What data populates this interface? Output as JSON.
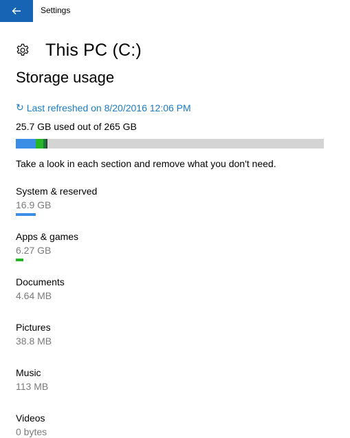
{
  "window": {
    "app_title": "Settings"
  },
  "header": {
    "title": "This PC (C:)"
  },
  "section": {
    "title": "Storage usage"
  },
  "refresh": {
    "icon": "↻",
    "label": "Last refreshed on 8/20/2016 12:06 PM"
  },
  "summary": {
    "used_text": "25.7 GB used out of 265 GB",
    "used_gb": 25.7,
    "total_gb": 265
  },
  "hint": "Take a look in each section and remove what you don't need.",
  "colors": {
    "accent": "#1764b5",
    "link": "#1a7bc9",
    "system_bar": "#3a8ee6",
    "apps_bar": "#26b526",
    "other_bar": "#1a7a3a",
    "bar_track": "#d4d4d4"
  },
  "categories": [
    {
      "name": "System & reserved",
      "size": "16.9 GB",
      "has_bar": true,
      "bar_color": "#3a8ee6",
      "bar_fraction": 0.064
    },
    {
      "name": "Apps & games",
      "size": "6.27 GB",
      "has_bar": true,
      "bar_color": "#26b526",
      "bar_fraction": 0.024
    },
    {
      "name": "Documents",
      "size": "4.64 MB",
      "has_bar": false
    },
    {
      "name": "Pictures",
      "size": "38.8 MB",
      "has_bar": false
    },
    {
      "name": "Music",
      "size": "113 MB",
      "has_bar": false
    },
    {
      "name": "Videos",
      "size": "0 bytes",
      "has_bar": false
    }
  ]
}
